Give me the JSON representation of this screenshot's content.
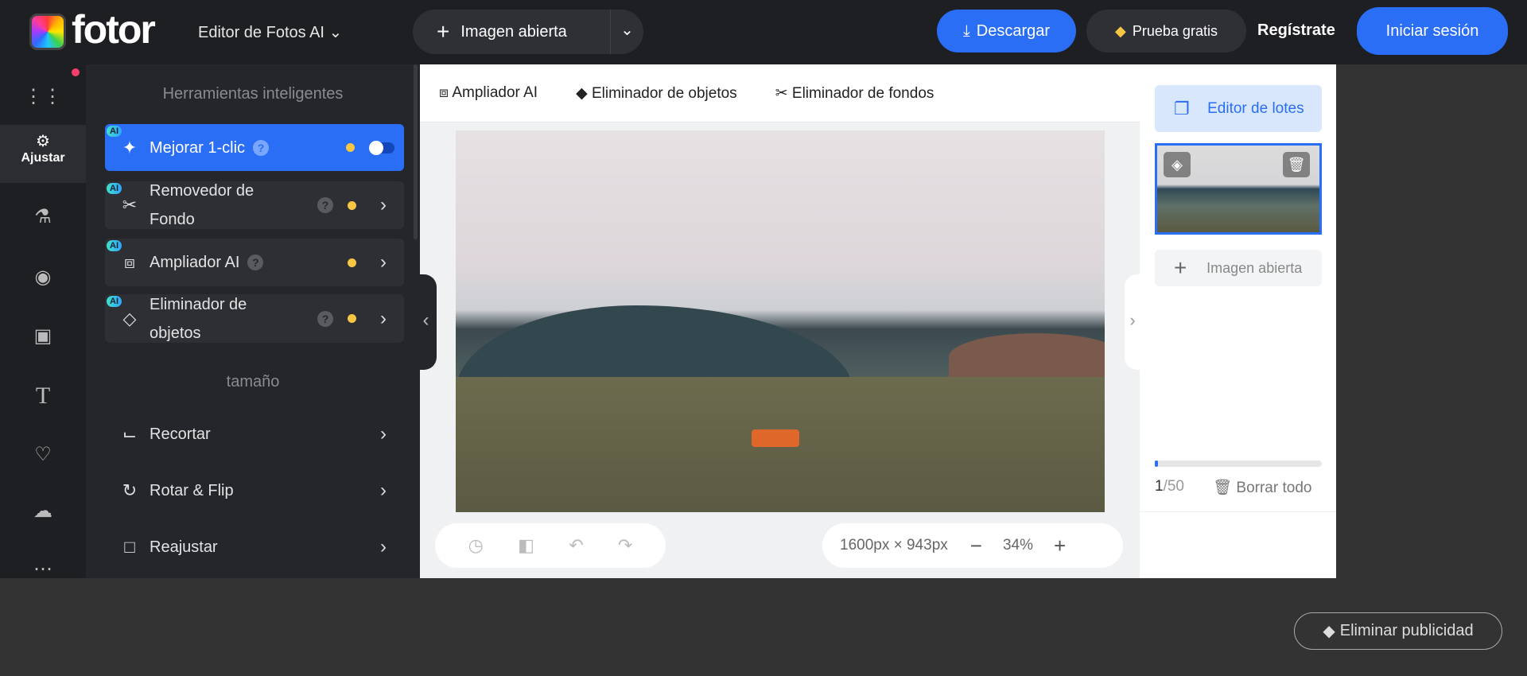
{
  "header": {
    "brand": "fotor",
    "product_menu": "Editor de Fotos AI",
    "open_image": "Imagen abierta",
    "download": "Descargar",
    "trial": "Prueba gratis",
    "register": "Regístrate",
    "login": "Iniciar sesión"
  },
  "rail": {
    "active_label": "Ajustar"
  },
  "tools": {
    "smart_heading": "Herramientas inteligentes",
    "smart": [
      {
        "label": "Mejorar 1-clic",
        "badge": "AI",
        "toggle": "on-off",
        "active": true
      },
      {
        "label": "Removedor de Fondo",
        "badge": "AI"
      },
      {
        "label": "Ampliador AI",
        "badge": "AI"
      },
      {
        "label": "Eliminador de objetos",
        "badge": "AI"
      }
    ],
    "size_heading": "tamaño",
    "size": [
      {
        "label": "Recortar"
      },
      {
        "label": "Rotar & Flip"
      },
      {
        "label": "Reajustar"
      }
    ]
  },
  "canvas_toolbar": [
    "Ampliador AI",
    "Eliminador de objetos",
    "Eliminador de fondos"
  ],
  "canvas": {
    "dimensions": "1600px × 943px",
    "zoom": "34%"
  },
  "right_panel": {
    "batch_editor": "Editor de lotes",
    "open_image": "Imagen abierta",
    "count_current": "1",
    "count_total": "/50",
    "progress": 0.02,
    "clear_all": "Borrar todo"
  },
  "footer": {
    "remove_ads": "Eliminar publicidad"
  },
  "colors": {
    "accent": "#2b6ef6",
    "dark": "#1e1f23",
    "panel": "#25262b",
    "dot": "#f7c744"
  }
}
